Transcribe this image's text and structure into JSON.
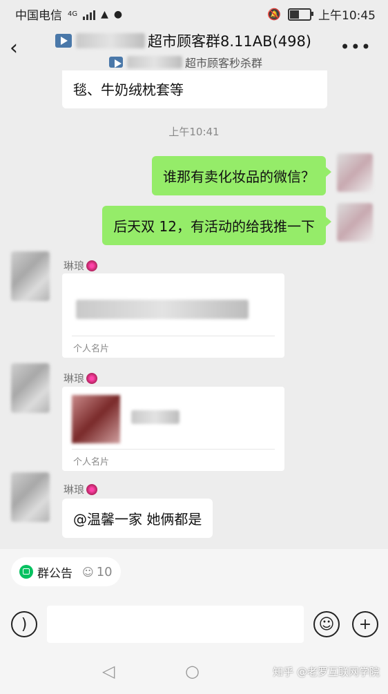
{
  "status": {
    "carrier": "中国电信",
    "network": "4G",
    "time": "上午10:45"
  },
  "header": {
    "group_title_suffix": "超市顾客群8.11AB(498)",
    "group_subtitle_suffix": "超市顾客秒杀群",
    "more_label": "•••"
  },
  "messages": {
    "partial_top": "毯、牛奶绒枕套等",
    "timestamp": "上午10:41",
    "outgoing": [
      "谁那有卖化妆品的微信？",
      "后天双 12，有活动的给我推一下"
    ],
    "sender_name": "琳琅",
    "card_label": "个人名片",
    "last_message": "@温馨一家  她俩都是"
  },
  "bottom": {
    "notice_label": "群公告",
    "member_count": "10"
  },
  "watermark": "知乎 @老罗互联网学院",
  "icons": {
    "back": "chevron-left-icon",
    "voice": "voice-icon",
    "emoji": "emoji-icon",
    "add": "plus-icon"
  }
}
